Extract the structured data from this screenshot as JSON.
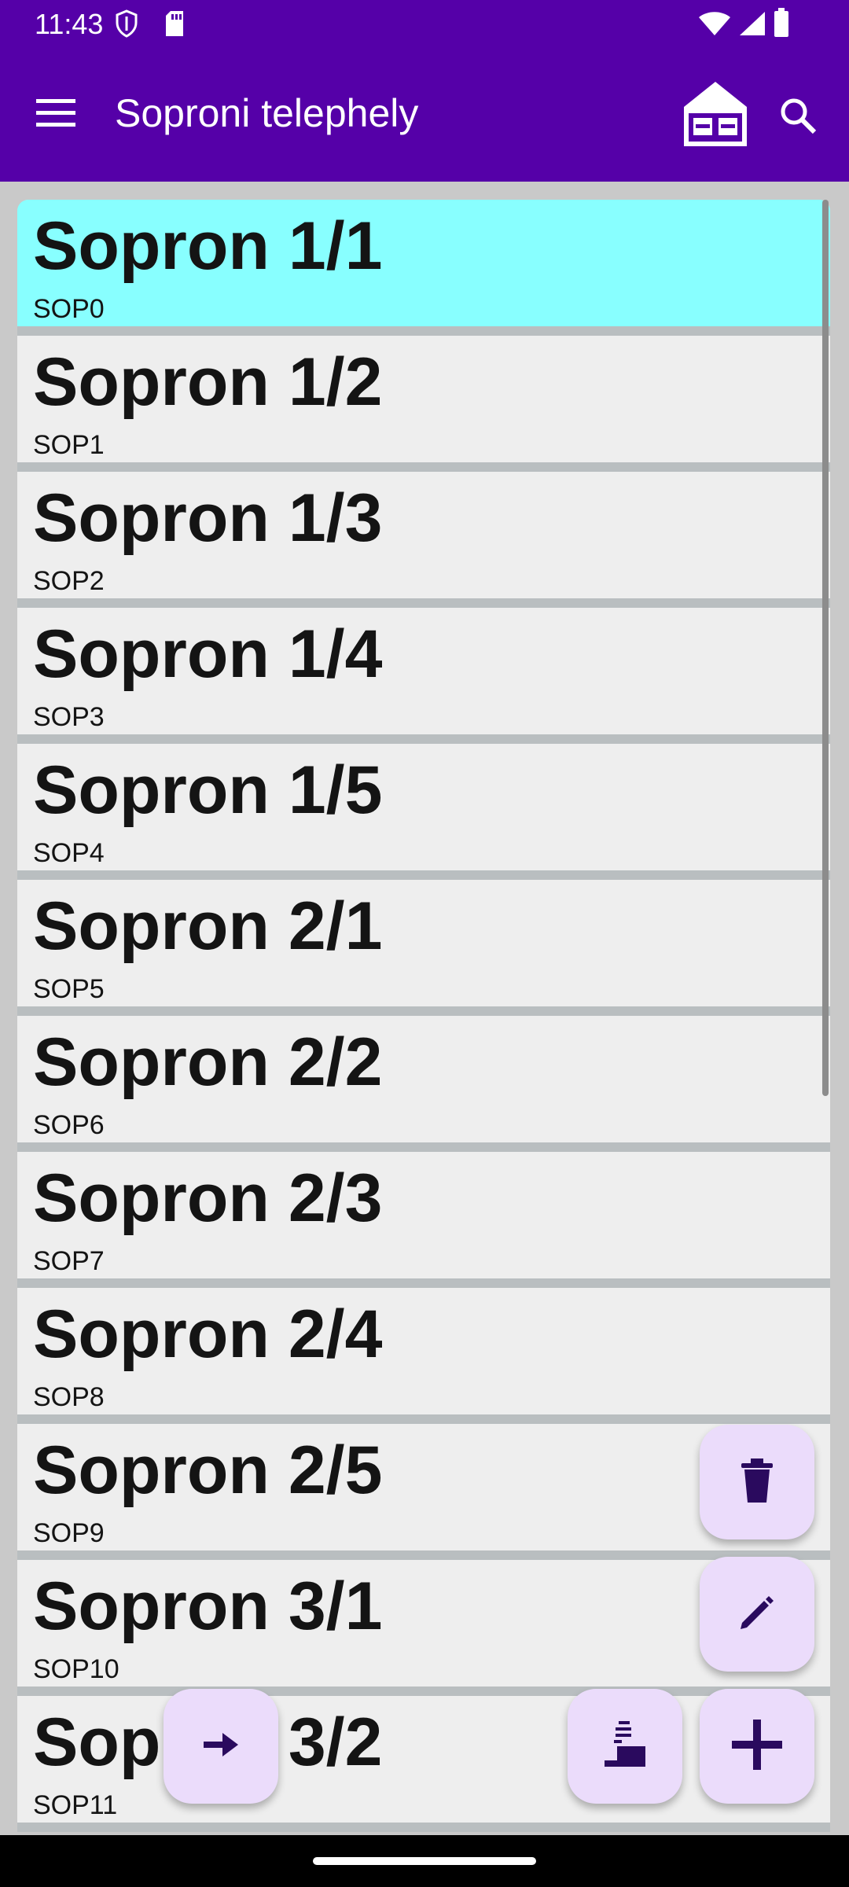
{
  "status_bar": {
    "time": "11:43"
  },
  "app_bar": {
    "title": "Soproni telephely"
  },
  "colors": {
    "primary": "#5500a8",
    "selected_item": "#88ffff",
    "fab_bg": "#ebdcfb",
    "fab_icon": "#2a0a5e"
  },
  "items": [
    {
      "name": "Sopron 1/1",
      "code": "SOP0",
      "selected": true
    },
    {
      "name": "Sopron 1/2",
      "code": "SOP1"
    },
    {
      "name": "Sopron 1/3",
      "code": "SOP2"
    },
    {
      "name": "Sopron 1/4",
      "code": "SOP3"
    },
    {
      "name": "Sopron 1/5",
      "code": "SOP4"
    },
    {
      "name": "Sopron 2/1",
      "code": "SOP5"
    },
    {
      "name": "Sopron 2/2",
      "code": "SOP6"
    },
    {
      "name": "Sopron 2/3",
      "code": "SOP7"
    },
    {
      "name": "Sopron 2/4",
      "code": "SOP8"
    },
    {
      "name": "Sopron 2/5",
      "code": "SOP9"
    },
    {
      "name": "Sopron 3/1",
      "code": "SOP10"
    },
    {
      "name": "Sopron 3/2",
      "code": "SOP11"
    }
  ],
  "icons": {
    "menu": "hamburger-menu-icon",
    "home": "warehouse-icon",
    "search": "search-icon",
    "delete": "trash-icon",
    "edit": "pencil-icon",
    "forward": "arrow-right-icon",
    "stack": "stack-boxes-icon",
    "add": "plus-icon"
  }
}
